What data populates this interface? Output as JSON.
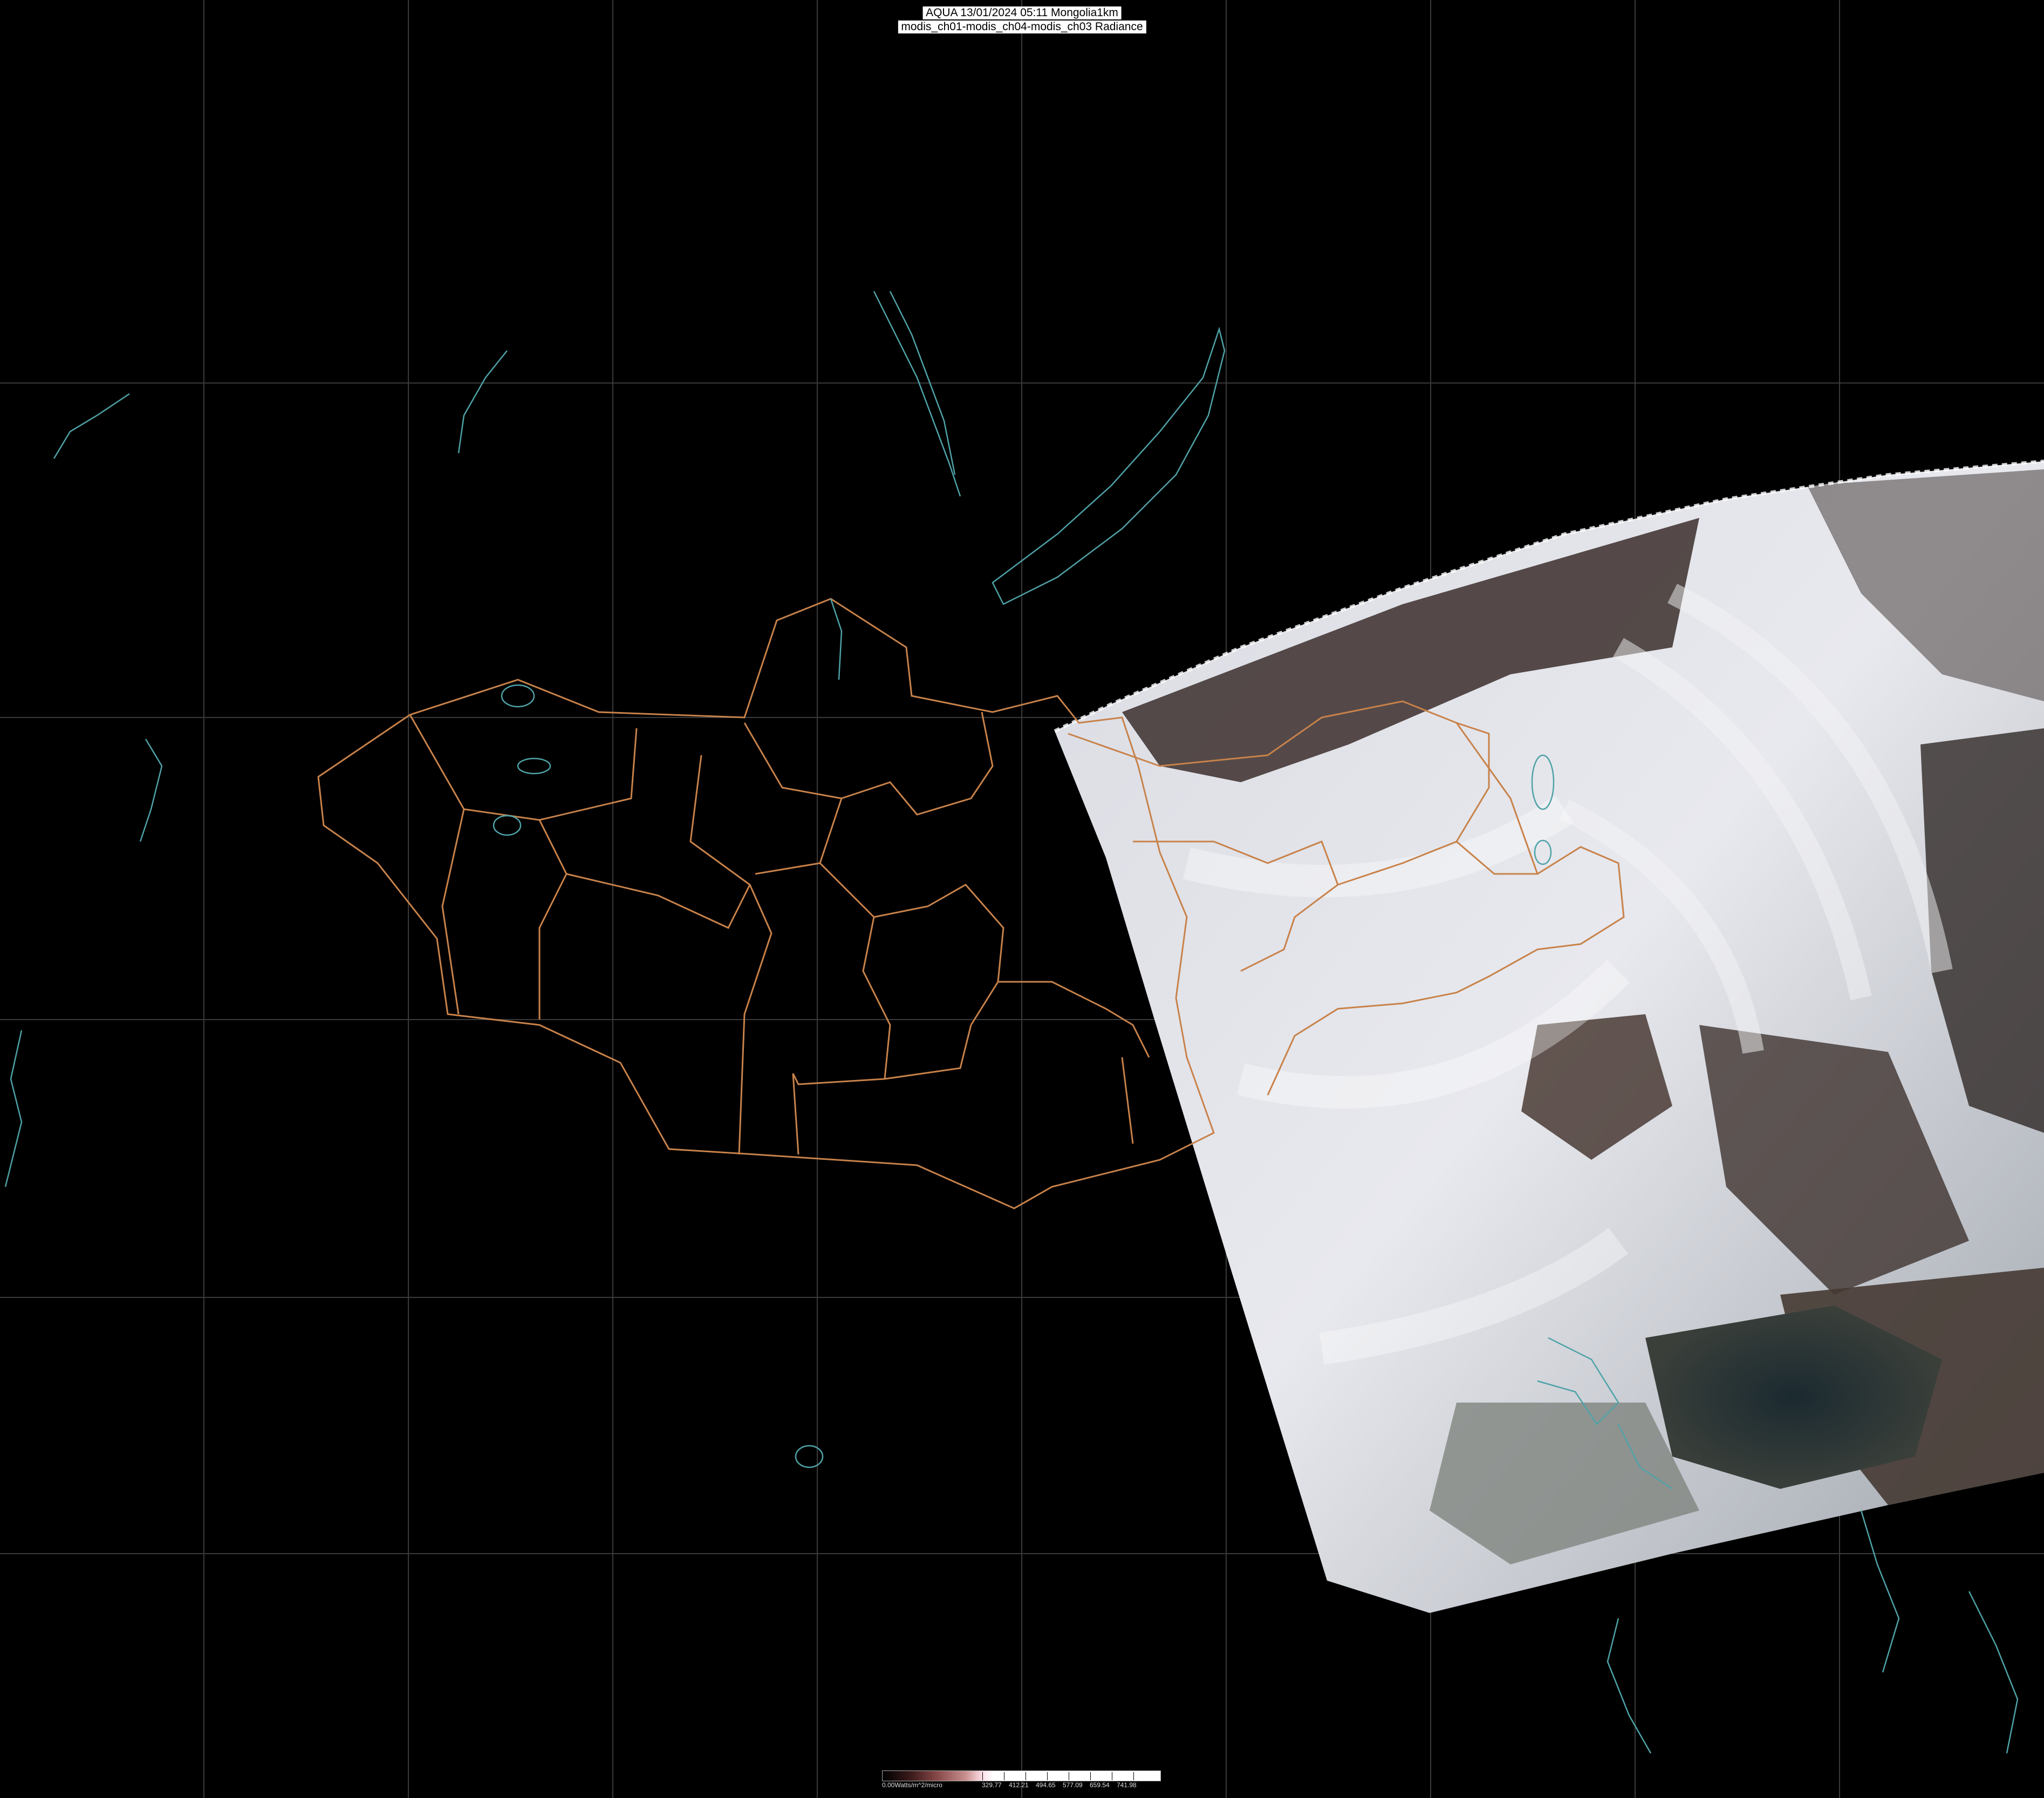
{
  "title": {
    "line1": "AQUA 13/01/2024 05:11 Mongolia1km",
    "line2": "modis_ch01-modis_ch04-modis_ch03 Radiance"
  },
  "legend": {
    "unit_label": "0.00Watts/m^2/micro",
    "ticks": [
      "329.77",
      "412.21",
      "494.65",
      "577.09",
      "659.54",
      "741.98"
    ]
  },
  "colors": {
    "background": "#000000",
    "graticule": "#3a3a3a",
    "admin_border": "#c8824a",
    "coastline": "#4fa3a8"
  }
}
